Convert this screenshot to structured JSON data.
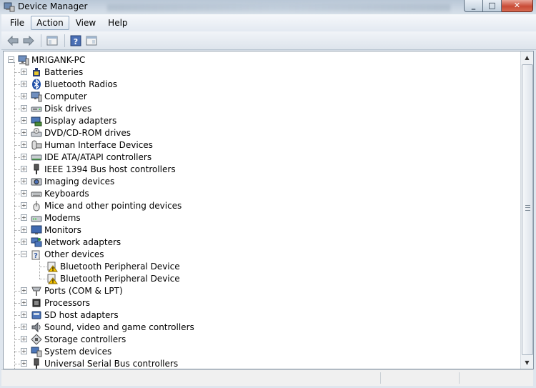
{
  "window": {
    "title": "Device Manager"
  },
  "menu": {
    "items": [
      "File",
      "Action",
      "View",
      "Help"
    ],
    "active": "Action"
  },
  "tree": {
    "root": "MRIGANK-PC",
    "items": [
      {
        "label": "Batteries",
        "icon": "battery-icon"
      },
      {
        "label": "Bluetooth Radios",
        "icon": "bluetooth-icon"
      },
      {
        "label": "Computer",
        "icon": "computer-icon"
      },
      {
        "label": "Disk drives",
        "icon": "disk-drive-icon"
      },
      {
        "label": "Display adapters",
        "icon": "display-adapter-icon"
      },
      {
        "label": "DVD/CD-ROM drives",
        "icon": "dvd-drive-icon"
      },
      {
        "label": "Human Interface Devices",
        "icon": "hid-icon"
      },
      {
        "label": "IDE ATA/ATAPI controllers",
        "icon": "ide-controller-icon"
      },
      {
        "label": "IEEE 1394 Bus host controllers",
        "icon": "firewire-icon"
      },
      {
        "label": "Imaging devices",
        "icon": "imaging-icon"
      },
      {
        "label": "Keyboards",
        "icon": "keyboard-icon"
      },
      {
        "label": "Mice and other pointing devices",
        "icon": "mouse-icon"
      },
      {
        "label": "Modems",
        "icon": "modem-icon"
      },
      {
        "label": "Monitors",
        "icon": "monitor-icon"
      },
      {
        "label": "Network adapters",
        "icon": "network-adapter-icon"
      },
      {
        "label": "Other devices",
        "icon": "unknown-device-icon",
        "expanded": true,
        "children": [
          "Bluetooth Peripheral Device",
          "Bluetooth Peripheral Device"
        ]
      },
      {
        "label": "Ports (COM & LPT)",
        "icon": "port-icon"
      },
      {
        "label": "Processors",
        "icon": "processor-icon"
      },
      {
        "label": "SD host adapters",
        "icon": "sd-adapter-icon"
      },
      {
        "label": "Sound, video and game controllers",
        "icon": "speaker-icon"
      },
      {
        "label": "Storage controllers",
        "icon": "storage-controller-icon"
      },
      {
        "label": "System devices",
        "icon": "system-device-icon"
      },
      {
        "label": "Universal Serial Bus controllers",
        "icon": "usb-icon"
      }
    ]
  },
  "colors": {
    "warning": "#f5c400",
    "titlebar": "#c4d1de",
    "accent": "#2b58a8"
  }
}
